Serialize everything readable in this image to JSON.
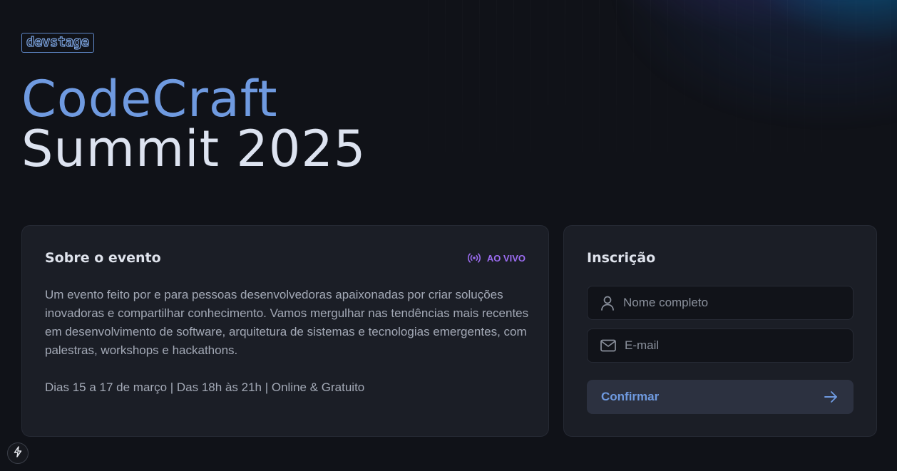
{
  "brand": {
    "logo_text": "devstage"
  },
  "hero": {
    "title_line1": "CodeCraft",
    "title_line2": "Summit 2025"
  },
  "about": {
    "title": "Sobre o evento",
    "live_badge": "AO VIVO",
    "description": "Um evento feito por e para pessoas desenvolvedoras apaixonadas por criar soluções inovadoras e compartilhar conhecimento. Vamos mergulhar nas tendências mais recentes em desenvolvimento de software, arquitetura de sistemas e tecnologias emergentes, com palestras, workshops e hackathons.",
    "dates": "Dias 15 a 17 de março | Das 18h às 21h | Online & Gratuito"
  },
  "signup": {
    "title": "Inscrição",
    "name_placeholder": "Nome completo",
    "name_value": "",
    "email_placeholder": "E-mail",
    "email_value": "",
    "confirm_label": "Confirmar"
  },
  "icons": {
    "live": "radio-broadcast-icon",
    "name": "user-icon",
    "email": "mail-icon",
    "confirm": "arrow-right-icon",
    "dev_indicator": "lightning-icon"
  },
  "colors": {
    "background": "#101218",
    "card": "#1b1e26",
    "accent_blue": "#6f9ae0",
    "live_purple": "#9b6cf0",
    "title_white": "#dde3f0"
  }
}
